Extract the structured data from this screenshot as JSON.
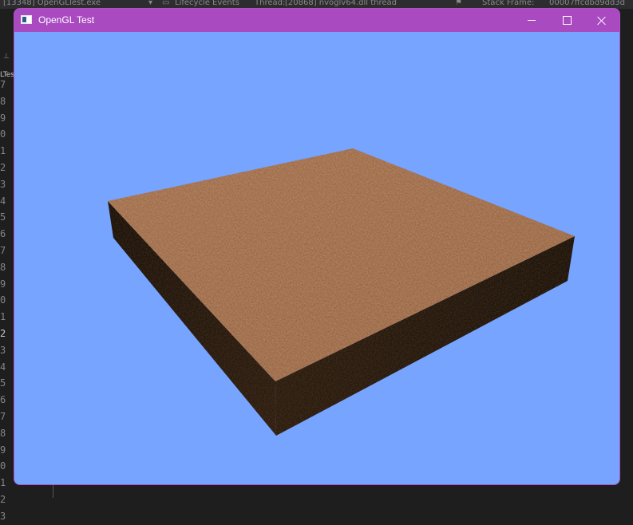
{
  "ide": {
    "process": "[13348] OpenGLTest.exe",
    "lifecycle": "Lifecycle Events",
    "thread_label": "Thread:",
    "thread": "[20868] nvoglv64.dll thread",
    "stack_frame_label": "Stack Frame:",
    "stack_frame": "00007ffcdbd9dd3d",
    "side_tab": "LTes",
    "line_numbers": [
      "7",
      "8",
      "9",
      "0",
      "1",
      "2",
      "3",
      "4",
      "5",
      "6",
      "7",
      "8",
      "9",
      "0",
      "1",
      "2",
      "3",
      "4",
      "5",
      "6",
      "7",
      "8",
      "9",
      "0",
      "1",
      "2",
      "3"
    ],
    "active_line_index": 15
  },
  "window": {
    "title": "OpenGL Test",
    "titlebar_color": "#a94ac1",
    "clear_color": "#76a4ff"
  },
  "scene": {
    "object": "textured box",
    "top_texture": "dirt",
    "top_color": "#9a6542",
    "side_color": "#24160c"
  }
}
